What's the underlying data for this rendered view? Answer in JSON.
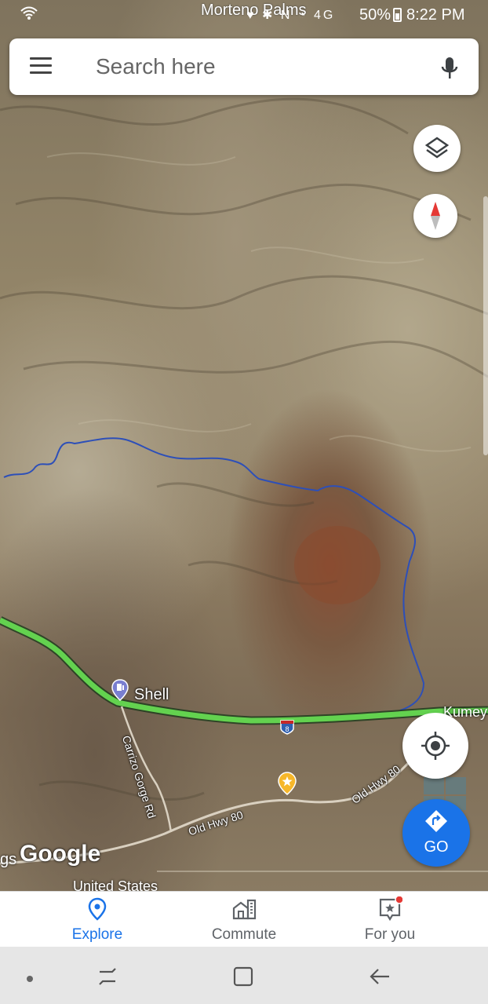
{
  "status_bar": {
    "place": "Morteno Palms",
    "network": "4G",
    "battery": "50%",
    "time": "8:22 PM"
  },
  "search": {
    "placeholder": "Search here"
  },
  "map": {
    "labels": {
      "gas_station": "Shell",
      "road_carrizo": "Carrizo Gorge Rd",
      "road_old_hwy_1": "Old Hwy 80",
      "road_old_hwy_2": "Old Hwy 80",
      "highway_shield": "8",
      "place_east": "Kumey",
      "google_logo": "Google",
      "left_fragment": "gs",
      "bottom_fragment": "United States"
    },
    "colors": {
      "route_blue": "#2d4fb8",
      "traffic_green": "#63d24f",
      "go_blue": "#1a73e8"
    }
  },
  "buttons": {
    "go_label": "GO"
  },
  "bottom_nav": {
    "items": [
      {
        "label": "Explore",
        "icon": "location-pin-icon",
        "active": true
      },
      {
        "label": "Commute",
        "icon": "commute-icon",
        "active": false
      },
      {
        "label": "For you",
        "icon": "for-you-icon",
        "active": false
      }
    ]
  }
}
